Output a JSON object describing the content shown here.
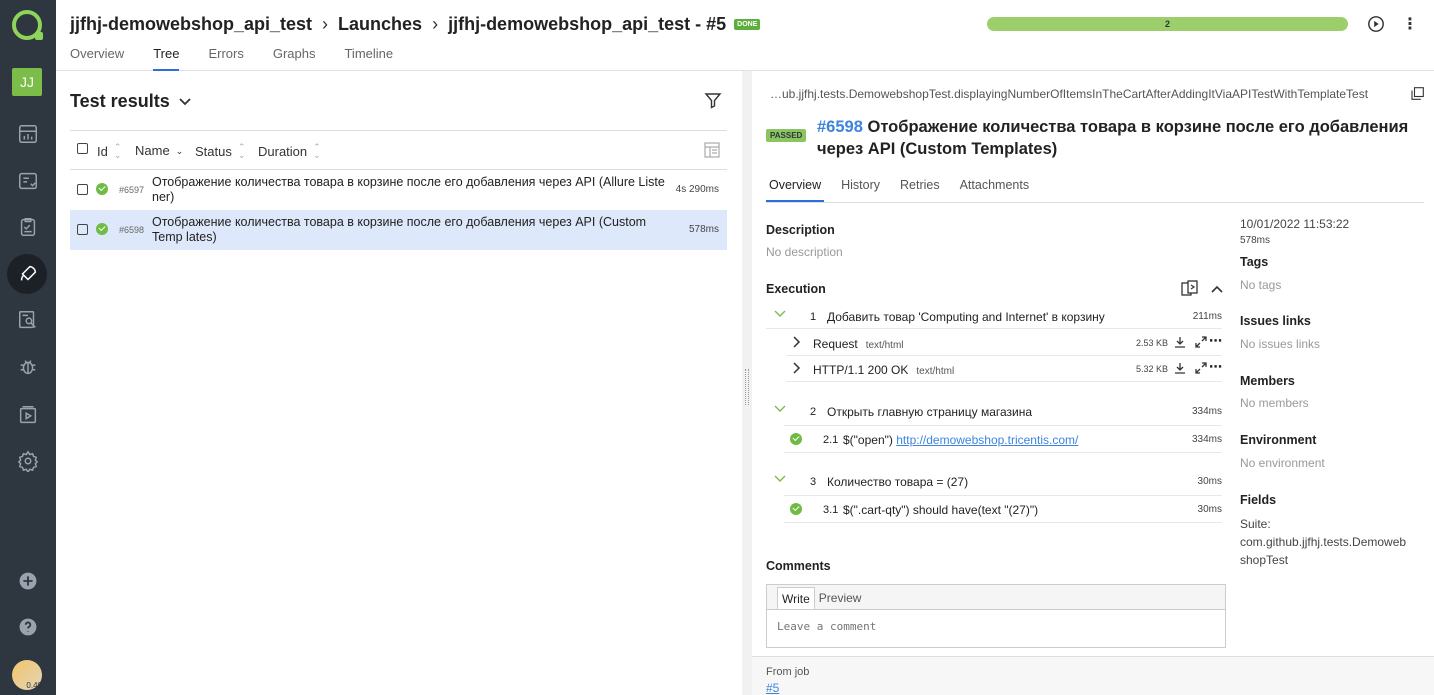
{
  "sidebar": {
    "avatar_initials": "JJ",
    "icons": [
      "dashboard-icon",
      "testcases-icon",
      "test-plans-icon",
      "launches-icon",
      "analytics-icon",
      "defects-icon",
      "jobs-icon",
      "settings-icon"
    ],
    "bottom_avatar_text": "0.40"
  },
  "header": {
    "crumb_project": "jjfhj-demowebshop_api_test",
    "crumb_launches": "Launches",
    "crumb_launch": "jjfhj-demowebshop_api_test - #5",
    "done_badge": "DONE",
    "progress_label": "2",
    "progress_fraction": 1.0,
    "tabs": [
      "Overview",
      "Tree",
      "Errors",
      "Graphs",
      "Timeline"
    ],
    "active_tab": "Tree"
  },
  "left": {
    "title": "Test results",
    "columns": [
      "Id",
      "Name",
      "Status",
      "Duration"
    ],
    "rows": [
      {
        "id": "#6597",
        "name": "Отображение количества товара в корзине после его добавления через API (Allure Liste ner)",
        "duration": "4s 290ms"
      },
      {
        "id": "#6598",
        "name": "Отображение количества товара в корзине после его добавления через API (Custom Temp lates)",
        "duration": "578ms"
      }
    ]
  },
  "right": {
    "path": "…ub.jjfhj.tests.DemowebshopTest.displayingNumberOfItemsInTheCartAfterAddingItViaAPITestWithTemplateTest",
    "status": "PASSED",
    "test_id": "#6598",
    "test_title": "Отображение количества товара в корзине после его добавления через API (Custom Templates)",
    "tabs": [
      "Overview",
      "History",
      "Retries",
      "Attachments"
    ],
    "description_label": "Description",
    "description_value": "No description",
    "execution_label": "Execution",
    "steps": {
      "s1": {
        "num": "1",
        "label": "Добавить товар 'Computing and Internet' в корзину",
        "ms": "211ms"
      },
      "req": {
        "label": "Request",
        "mime": "text/html",
        "size": "2.53 KB"
      },
      "resp": {
        "label": "HTTP/1.1 200 OK",
        "mime": "text/html",
        "size": "5.32 KB"
      },
      "s2": {
        "num": "2",
        "label": "Открыть главную страницу магазина",
        "ms": "334ms"
      },
      "s21": {
        "num": "2.1",
        "label": "$(\"open\")",
        "link": "http://demowebshop.tricentis.com/",
        "ms": "334ms"
      },
      "s3": {
        "num": "3",
        "label": "Количество товара = (27)",
        "ms": "30ms"
      },
      "s31": {
        "num": "3.1",
        "label": "$(\".cart-qty\") should have(text \"(27)\")",
        "ms": "30ms"
      }
    },
    "comments_label": "Comments",
    "write_tab": "Write",
    "preview_tab": "Preview",
    "comment_placeholder": "Leave a comment",
    "meta": {
      "date": "10/01/2022 11:53:22",
      "duration": "578ms",
      "tags_label": "Tags",
      "tags_value": "No tags",
      "issues_label": "Issues links",
      "issues_value": "No issues links",
      "members_label": "Members",
      "members_value": "No members",
      "env_label": "Environment",
      "env_value": "No environment",
      "fields_label": "Fields",
      "suite_line1": "Suite:",
      "suite_line2": "com.github.jjfhj.tests.Demoweb",
      "suite_line3": "shopTest"
    },
    "from_job_label": "From job",
    "from_job_link": "#5"
  }
}
